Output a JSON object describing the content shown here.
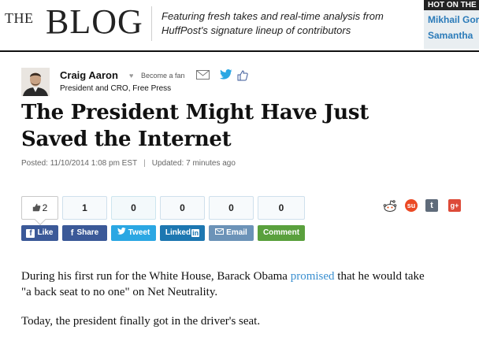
{
  "header": {
    "blog_prefix": "THE",
    "blog_word": "BLOG",
    "tagline_line1": "Featuring fresh takes and real-time analysis from",
    "tagline_line2": "HuffPost's signature lineup of contributors",
    "hot_title": "HOT ON THE BLOG",
    "hot_items": [
      "Mikhail Gorbachev",
      "Samantha"
    ]
  },
  "author": {
    "name": "Craig Aaron",
    "fan_label": "Become a fan",
    "title": "President and CRO, Free Press"
  },
  "article": {
    "title_line1": "The President Might Have Just",
    "title_line2": "Saved the Internet",
    "posted": "Posted: 11/10/2014 1:08 pm EST",
    "updated": "Updated: 7 minutes ago",
    "para1_before": "During his first run for the White House, Barack Obama ",
    "para1_link": "promised",
    "para1_after": " that he would take",
    "para1_line2": "\"a back seat to no one\" on Net Neutrality.",
    "para2": "Today, the president finally got in the driver's seat."
  },
  "share": {
    "counts": {
      "like": "2",
      "facebook": "1",
      "twitter": "0",
      "linkedin": "0",
      "email": "0",
      "comment": "0"
    },
    "labels": {
      "like": "Like",
      "share": "Share",
      "tweet": "Tweet",
      "linkedin": "Linked",
      "linkedin_in": "in",
      "email": "Email",
      "comment": "Comment"
    },
    "social_icons": [
      "reddit-icon",
      "stumbleupon-icon",
      "tumblr-icon",
      "google-plus-icon"
    ]
  },
  "colors": {
    "facebook": "#3b5998",
    "twitter": "#2ba7e3",
    "linkedin": "#1d77b1",
    "email": "#6c93b8",
    "comment": "#5aa03d",
    "link": "#3a8fd0",
    "accent_blue": "#2b7bb9"
  }
}
